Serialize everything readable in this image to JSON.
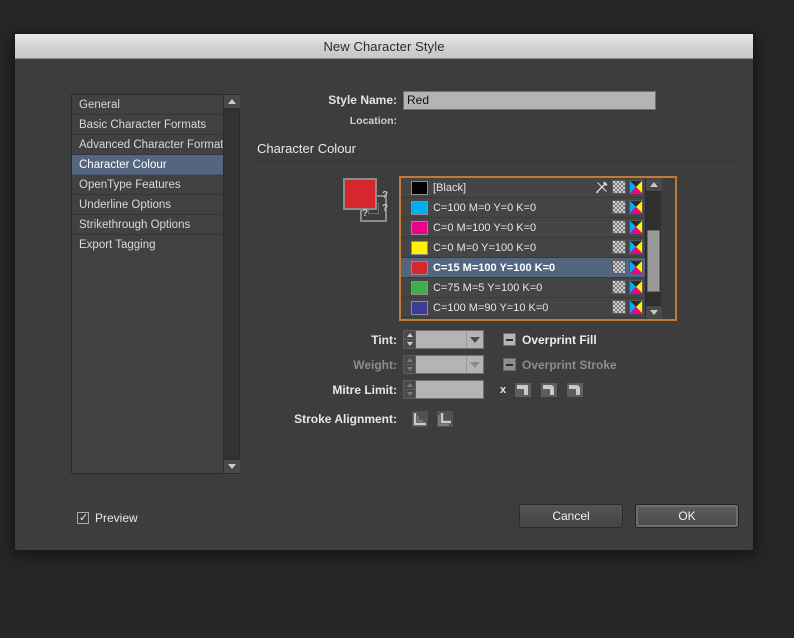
{
  "window": {
    "title": "New Character Style"
  },
  "sidebar": {
    "items": [
      {
        "label": "General",
        "selected": false
      },
      {
        "label": "Basic Character Formats",
        "selected": false
      },
      {
        "label": "Advanced Character Formats",
        "selected": false
      },
      {
        "label": "Character Colour",
        "selected": true
      },
      {
        "label": "OpenType Features",
        "selected": false
      },
      {
        "label": "Underline Options",
        "selected": false
      },
      {
        "label": "Strikethrough Options",
        "selected": false
      },
      {
        "label": "Export Tagging",
        "selected": false
      }
    ],
    "scroll_up_icon": "triangle-up-icon",
    "scroll_down_icon": "triangle-down-icon"
  },
  "form": {
    "style_name_label": "Style Name:",
    "style_name_value": "Red",
    "style_name_placeholder": "",
    "location_label": "Location:",
    "location_value": ""
  },
  "section": {
    "title": "Character Colour"
  },
  "fill_stroke": {
    "fill_color": "#d6272e",
    "fill_name": "fill-swatch",
    "stroke_name": "stroke-swatch",
    "unknown_marks": [
      "?",
      "?",
      "?"
    ]
  },
  "swatches": {
    "rows": [
      {
        "name": "[Black]",
        "color": "#000000",
        "selected": false,
        "has_nib_icon": true
      },
      {
        "name": "C=100 M=0 Y=0 K=0",
        "color": "#00aeef",
        "selected": false,
        "has_nib_icon": false
      },
      {
        "name": "C=0 M=100 Y=0 K=0",
        "color": "#ec008c",
        "selected": false,
        "has_nib_icon": false
      },
      {
        "name": "C=0 M=0 Y=100 K=0",
        "color": "#fff200",
        "selected": false,
        "has_nib_icon": false
      },
      {
        "name": "C=15 M=100 Y=100 K=0",
        "color": "#d6272e",
        "selected": true,
        "has_nib_icon": false
      },
      {
        "name": "C=75 M=5 Y=100 K=0",
        "color": "#3dae49",
        "selected": false,
        "has_nib_icon": false
      },
      {
        "name": "C=100 M=90 Y=10 K=0",
        "color": "#3b3b98",
        "selected": false,
        "has_nib_icon": false
      }
    ],
    "row_icons": {
      "nib": "pen-nib-crossed-icon",
      "checker": "tint-checker-icon",
      "cmyk": "cmyk-process-icon"
    },
    "focus_border_color": "#c07a39"
  },
  "options": {
    "tint": {
      "label": "Tint:",
      "value": "",
      "has_dropdown": true,
      "enabled": true
    },
    "weight": {
      "label": "Weight:",
      "value": "",
      "has_dropdown": true,
      "enabled": false
    },
    "mitre_limit": {
      "label": "Mitre Limit:",
      "value": "",
      "has_dropdown": false,
      "enabled": true
    },
    "overprint_fill": {
      "label": "Overprint Fill",
      "state": "mixed",
      "enabled": true
    },
    "overprint_stroke": {
      "label": "Overprint Stroke",
      "state": "mixed",
      "enabled": false
    },
    "mitre_x": "x",
    "join_buttons": [
      {
        "name": "miter-join-button"
      },
      {
        "name": "bevel-join-button"
      },
      {
        "name": "round-join-button"
      }
    ],
    "stroke_alignment": {
      "label": "Stroke Alignment:",
      "buttons": [
        {
          "name": "align-stroke-inside-button"
        },
        {
          "name": "align-stroke-outside-button"
        }
      ]
    }
  },
  "footer": {
    "preview_label": "Preview",
    "preview_checked": true,
    "preview_tick": "✓",
    "cancel_label": "Cancel",
    "ok_label": "OK"
  },
  "colors": {
    "dialog_bg": "#3d3d3d",
    "desktop_bg": "#262626",
    "selection_blue": "#54657f",
    "accent_focus": "#c07a39"
  }
}
